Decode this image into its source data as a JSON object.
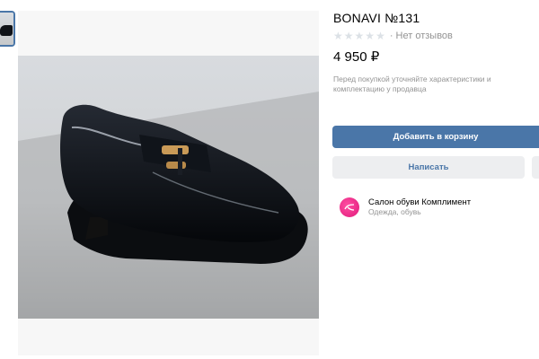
{
  "product": {
    "title": "BONAVI №131",
    "stars_filled": 0,
    "stars_total": 5,
    "no_reviews": "· Нет отзывов",
    "price": "4 950 ₽",
    "note": "Перед покупкой уточняйте характеристики и комплектацию у продавца"
  },
  "actions": {
    "add_to_cart": "Добавить в корзину",
    "write": "Написать"
  },
  "seller": {
    "name": "Салон обуви Комплимент",
    "category": "Одежда, обувь"
  },
  "colors": {
    "accent": "#4a76a8",
    "secondary_bg": "#edeef0",
    "muted_text": "#939393",
    "star_empty": "#dce1e6",
    "seller_avatar": "#e0197a"
  },
  "images": {
    "main": "black patent leather loafer with gold buckle"
  }
}
